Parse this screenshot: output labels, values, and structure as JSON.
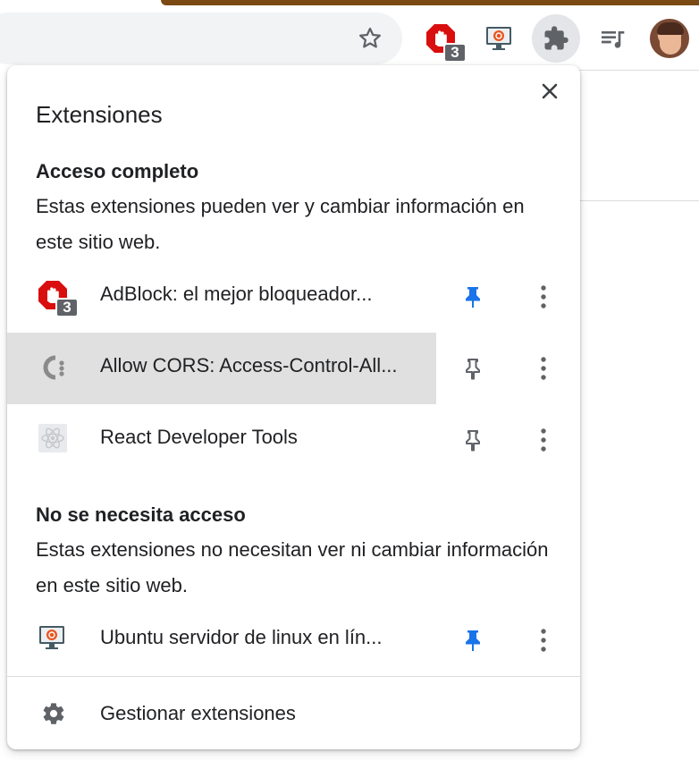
{
  "toolbar": {
    "adblock_badge": "3",
    "star_icon": "star-outline-icon",
    "extensions_icon": "puzzle-icon",
    "media_icon": "media-queue-icon"
  },
  "popup": {
    "title": "Extensiones",
    "full_access": {
      "title": "Acceso completo",
      "description": "Estas extensiones pueden ver y cambiar información en este sitio web.",
      "items": [
        {
          "name": "AdBlock: el mejor bloqueador...",
          "badge": "3",
          "pinned": true,
          "icon": "adblock-icon"
        },
        {
          "name": "Allow CORS: Access-Control-All...",
          "pinned": false,
          "icon": "cors-icon"
        },
        {
          "name": "React Developer Tools",
          "pinned": false,
          "icon": "react-icon"
        }
      ]
    },
    "no_access": {
      "title": "No se necesita acceso",
      "description": "Estas extensiones no necesitan ver ni cambiar información en este sitio web.",
      "items": [
        {
          "name": "Ubuntu servidor de linux en lín...",
          "pinned": true,
          "icon": "ubuntu-monitor-icon"
        }
      ]
    },
    "manage_label": "Gestionar extensiones"
  },
  "colors": {
    "pinned": "#1a73e8",
    "unpinned": "#5f6368",
    "adblock_red": "#d90e0e",
    "ubuntu_orange": "#e95420",
    "tabstrip": "#7a4a12"
  }
}
